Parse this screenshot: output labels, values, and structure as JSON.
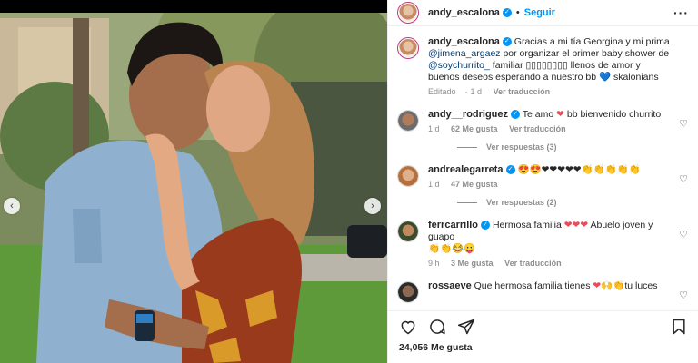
{
  "post": {
    "username": "andy_escalona",
    "follow_label": "Seguir",
    "caption": {
      "prefix": "Gracias a mi tía Georgina y mi prima ",
      "mention1": "@jimena_argaez",
      "middle": " por organizar el primer baby shower de ",
      "mention2": "@soychurrito_",
      "suffix": " familiar ▯▯▯▯▯▯▯▯ llenos de amor y buenos deseos esperando a nuestro bb 💙 skalonians"
    },
    "edited": "Editado",
    "age": "1 d",
    "translate": "Ver traducción"
  },
  "comments": [
    {
      "username": "andy__rodriguez",
      "text_before": "Te amo ",
      "emoji": "❤",
      "text_after": " bb bienvenido churrito",
      "age": "1 d",
      "likes": "62 Me gusta",
      "translate": "Ver traducción",
      "replies": "Ver respuestas (3)"
    },
    {
      "username": "andrealegarreta",
      "emoji": "😍😍❤❤❤❤❤👏👏👏👏👏",
      "age": "1 d",
      "likes": "47 Me gusta",
      "replies": "Ver respuestas (2)"
    },
    {
      "username": "ferrcarrillo",
      "text_before": "Hermosa familia ",
      "emoji": "❤❤❤",
      "text_after": " Abuelo joven y guapo",
      "emoji2": "👏👏😂😛",
      "age": "9 h",
      "likes": "3 Me gusta",
      "translate": "Ver traducción"
    },
    {
      "username": "rossaeve",
      "text_before": "Que hermosa familia tienes ",
      "emoji": "❤🙌👏",
      "text_after": "tu luces"
    }
  ],
  "footer": {
    "likes": "24,056 Me gusta"
  },
  "nav": {
    "prev": "‹",
    "next": "›"
  },
  "icons": {
    "header_more": "more-options-icon",
    "verified": "verified-badge-icon",
    "like": "heart-icon",
    "comment": "comment-icon",
    "share": "share-icon",
    "save": "bookmark-icon"
  },
  "colors": {
    "accent_blue": "#0095f6",
    "heart_red": "#ed4956",
    "meta_gray": "#8e8e8e"
  }
}
